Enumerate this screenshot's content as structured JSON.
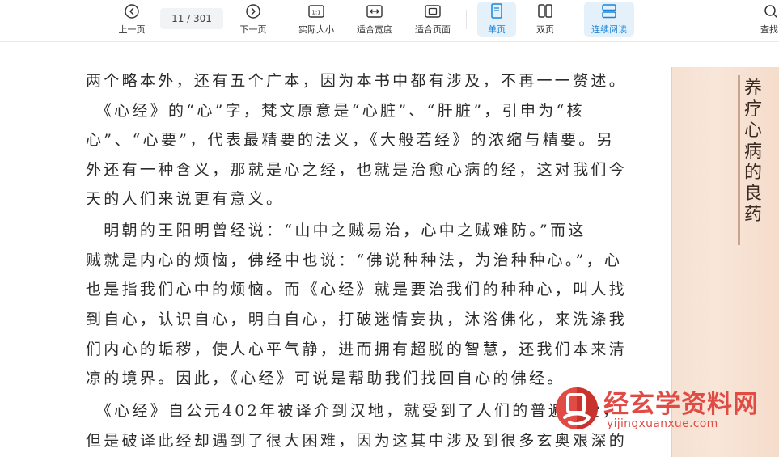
{
  "toolbar": {
    "prev_label": "上一页",
    "page_indicator": "11 / 301",
    "next_label": "下一页",
    "actual_size_icon_text": "1:1",
    "actual_size_label": "实际大小",
    "fit_width_label": "适合宽度",
    "fit_page_label": "适合页面",
    "single_page_label": "单页",
    "double_page_label": "双页",
    "continuous_label": "连续阅读",
    "search_label": "查找",
    "accent_color": "#1a84d8"
  },
  "page": {
    "lines": [
      "两个略本外，还有五个广本，因为本书中都有涉及，不再一一赘述。",
      "　《心经》的“心”字，梵文原意是“心脏”、“肝脏”，引申为“核",
      "心”、“心要”，代表最精要的法义，《大般若经》的浓缩与精要。另",
      "外还有一种含义，那就是心之经，也就是治愈心病的经，这对我们今",
      "天的人们来说更有意义。",
      "　明朝的王阳明曾经说：“山中之贼易治，心中之贼难防。”而这",
      "贼就是内心的烦恼，佛经中也说：“佛说种种法，为治种种心。”，心",
      "也是指我们心中的烦恼。而《心经》就是要治我们的种种心，叫人找",
      "到自心，认识自心，明白自心，打破迷情妄执，沐浴佛化，来洗涤我",
      "们内心的垢秽，使人心平气静，进而拥有超脱的智慧，还我们本来清",
      "凉的境界。因此，《心经》可说是帮助我们找回自心的佛经。",
      "　《心经》自公元402年被译介到汉地，就受到了人们的普遍喜爱，",
      "但是破译此经却遇到了很大困难，因为这其中涉及到很多玄奥艰深的"
    ],
    "side_title": "养疗心病的良药"
  },
  "watermark": {
    "name": "经玄学资料网",
    "url": "yijingxuanxue.com",
    "color": "#e04b45"
  }
}
